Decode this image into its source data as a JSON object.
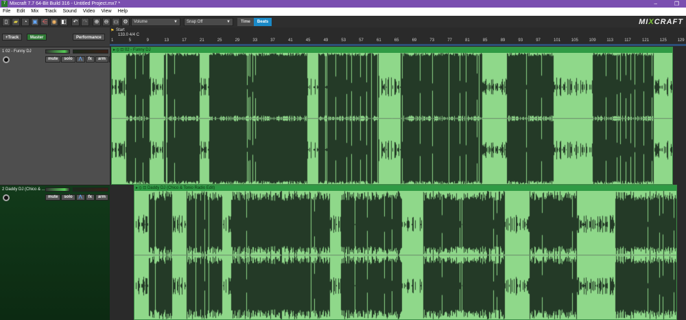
{
  "window": {
    "title": "Mixcraft 7.7 64-Bit Build 316 - Untitled Project.mx7 *",
    "minimize": "–",
    "maximize": "❐"
  },
  "menu": [
    "File",
    "Edit",
    "Mix",
    "Track",
    "Sound",
    "Video",
    "View",
    "Help"
  ],
  "toolbar": {
    "automation_dropdown": "Volume",
    "snap_dropdown": "Snap Off",
    "time_label": "Time",
    "beats_label": "Beats",
    "brand": "MIXCRAFT"
  },
  "left": {
    "add_track": "+Track",
    "master": "Master",
    "performance": "Performance"
  },
  "ruler": {
    "marker": "Start",
    "tempo": "133.0 4/4 C",
    "bars": [
      "1",
      "5",
      "9",
      "13",
      "17",
      "21",
      "25",
      "29",
      "33",
      "37",
      "41",
      "45",
      "49",
      "53",
      "57",
      "61",
      "65",
      "69",
      "73",
      "77",
      "81",
      "85",
      "89",
      "93",
      "97",
      "101",
      "105",
      "109",
      "113",
      "117",
      "121",
      "125",
      "129"
    ]
  },
  "tracks": [
    {
      "name": "1 02 - Funny DJ",
      "clip": "02 - Funny DJ",
      "buttons": [
        "mute",
        "solo",
        "fx",
        "arm",
        "-"
      ]
    },
    {
      "name": "2 Daddy DJ (Chico & ...",
      "clip": "Daddy DJ (Chico & Tonio Radio Edit)",
      "buttons": [
        "mute",
        "solo",
        "fx",
        "arm",
        "-"
      ]
    }
  ],
  "colors": {
    "title": "#7a4eb0",
    "wave": "#8fd88a",
    "clip_bg": "#243a27",
    "accent": "#1a8ac8"
  }
}
